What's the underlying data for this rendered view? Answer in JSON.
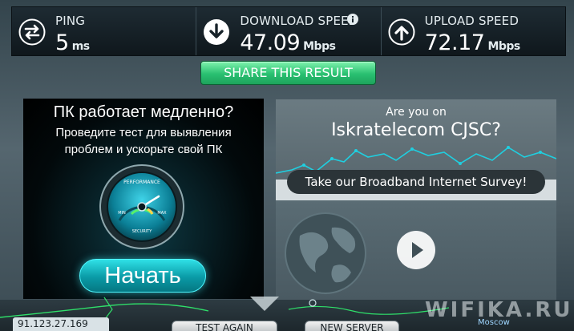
{
  "stats": {
    "ping": {
      "label": "PING",
      "value": "5",
      "unit": "ms",
      "icon": "ping-arrows-icon"
    },
    "download": {
      "label": "DOWNLOAD SPEED",
      "value": "47.09",
      "unit": "Mbps",
      "icon": "download-arrow-icon"
    },
    "upload": {
      "label": "UPLOAD SPEED",
      "value": "72.17",
      "unit": "Mbps",
      "icon": "upload-arrow-icon"
    }
  },
  "share_label": "SHARE THIS RESULT",
  "ad_left": {
    "headline": "ПК работает медленно?",
    "line1": "Проведите тест для выявления",
    "line2": "проблем и ускорьте свой ПК",
    "button": "Начать",
    "gauge": {
      "top": "PERFORMANCE",
      "min": "MIN",
      "max": "MAX",
      "bottom": "SECURITY"
    }
  },
  "ad_right": {
    "question": "Are you on",
    "isp": "Iskratelecom CJSC?",
    "survey_button": "Take our Broadband Internet Survey!"
  },
  "bottom": {
    "ip": "91.123.27.169",
    "test_again": "TEST AGAIN",
    "new_server": "NEW SERVER",
    "city": "Moscow"
  },
  "watermark": "WIFIKA.RU",
  "colors": {
    "accent_green": "#29c071",
    "accent_cyan": "#2fe0e6",
    "stat_bg": "#0f171c"
  }
}
